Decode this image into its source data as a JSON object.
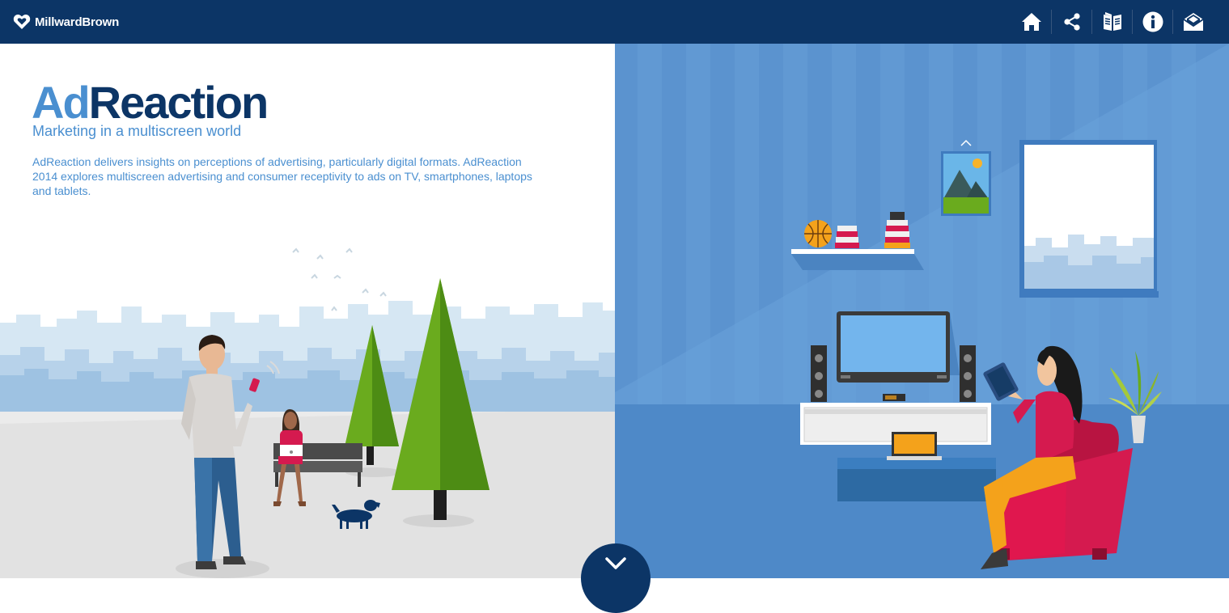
{
  "header": {
    "brand": "MillwardBrown",
    "brand_icon": "millwardbrown-logo-icon",
    "nav": [
      {
        "name": "home",
        "icon": "home-icon"
      },
      {
        "name": "share",
        "icon": "share-icon"
      },
      {
        "name": "report",
        "icon": "book-icon"
      },
      {
        "name": "info",
        "icon": "info-icon"
      },
      {
        "name": "contact",
        "icon": "envelope-icon"
      }
    ]
  },
  "hero": {
    "title_part1": "Ad",
    "title_part2": "Reaction",
    "subtitle": "Marketing in a multiscreen world",
    "description": "AdReaction delivers insights on perceptions of advertising, particularly digital formats. AdReaction 2014 explores multiscreen advertising and consumer receptivity to ads on TV, smartphones, laptops and tablets."
  },
  "scroll_button": {
    "icon": "chevron-down-icon"
  },
  "colors": {
    "navy": "#0c3566",
    "accent_blue": "#4a8fd0",
    "room_blue": "#5b93cf",
    "sofa_red": "#e0174e",
    "tree_green": "#6aab1e",
    "sky_pale": "#d6e7f3"
  }
}
